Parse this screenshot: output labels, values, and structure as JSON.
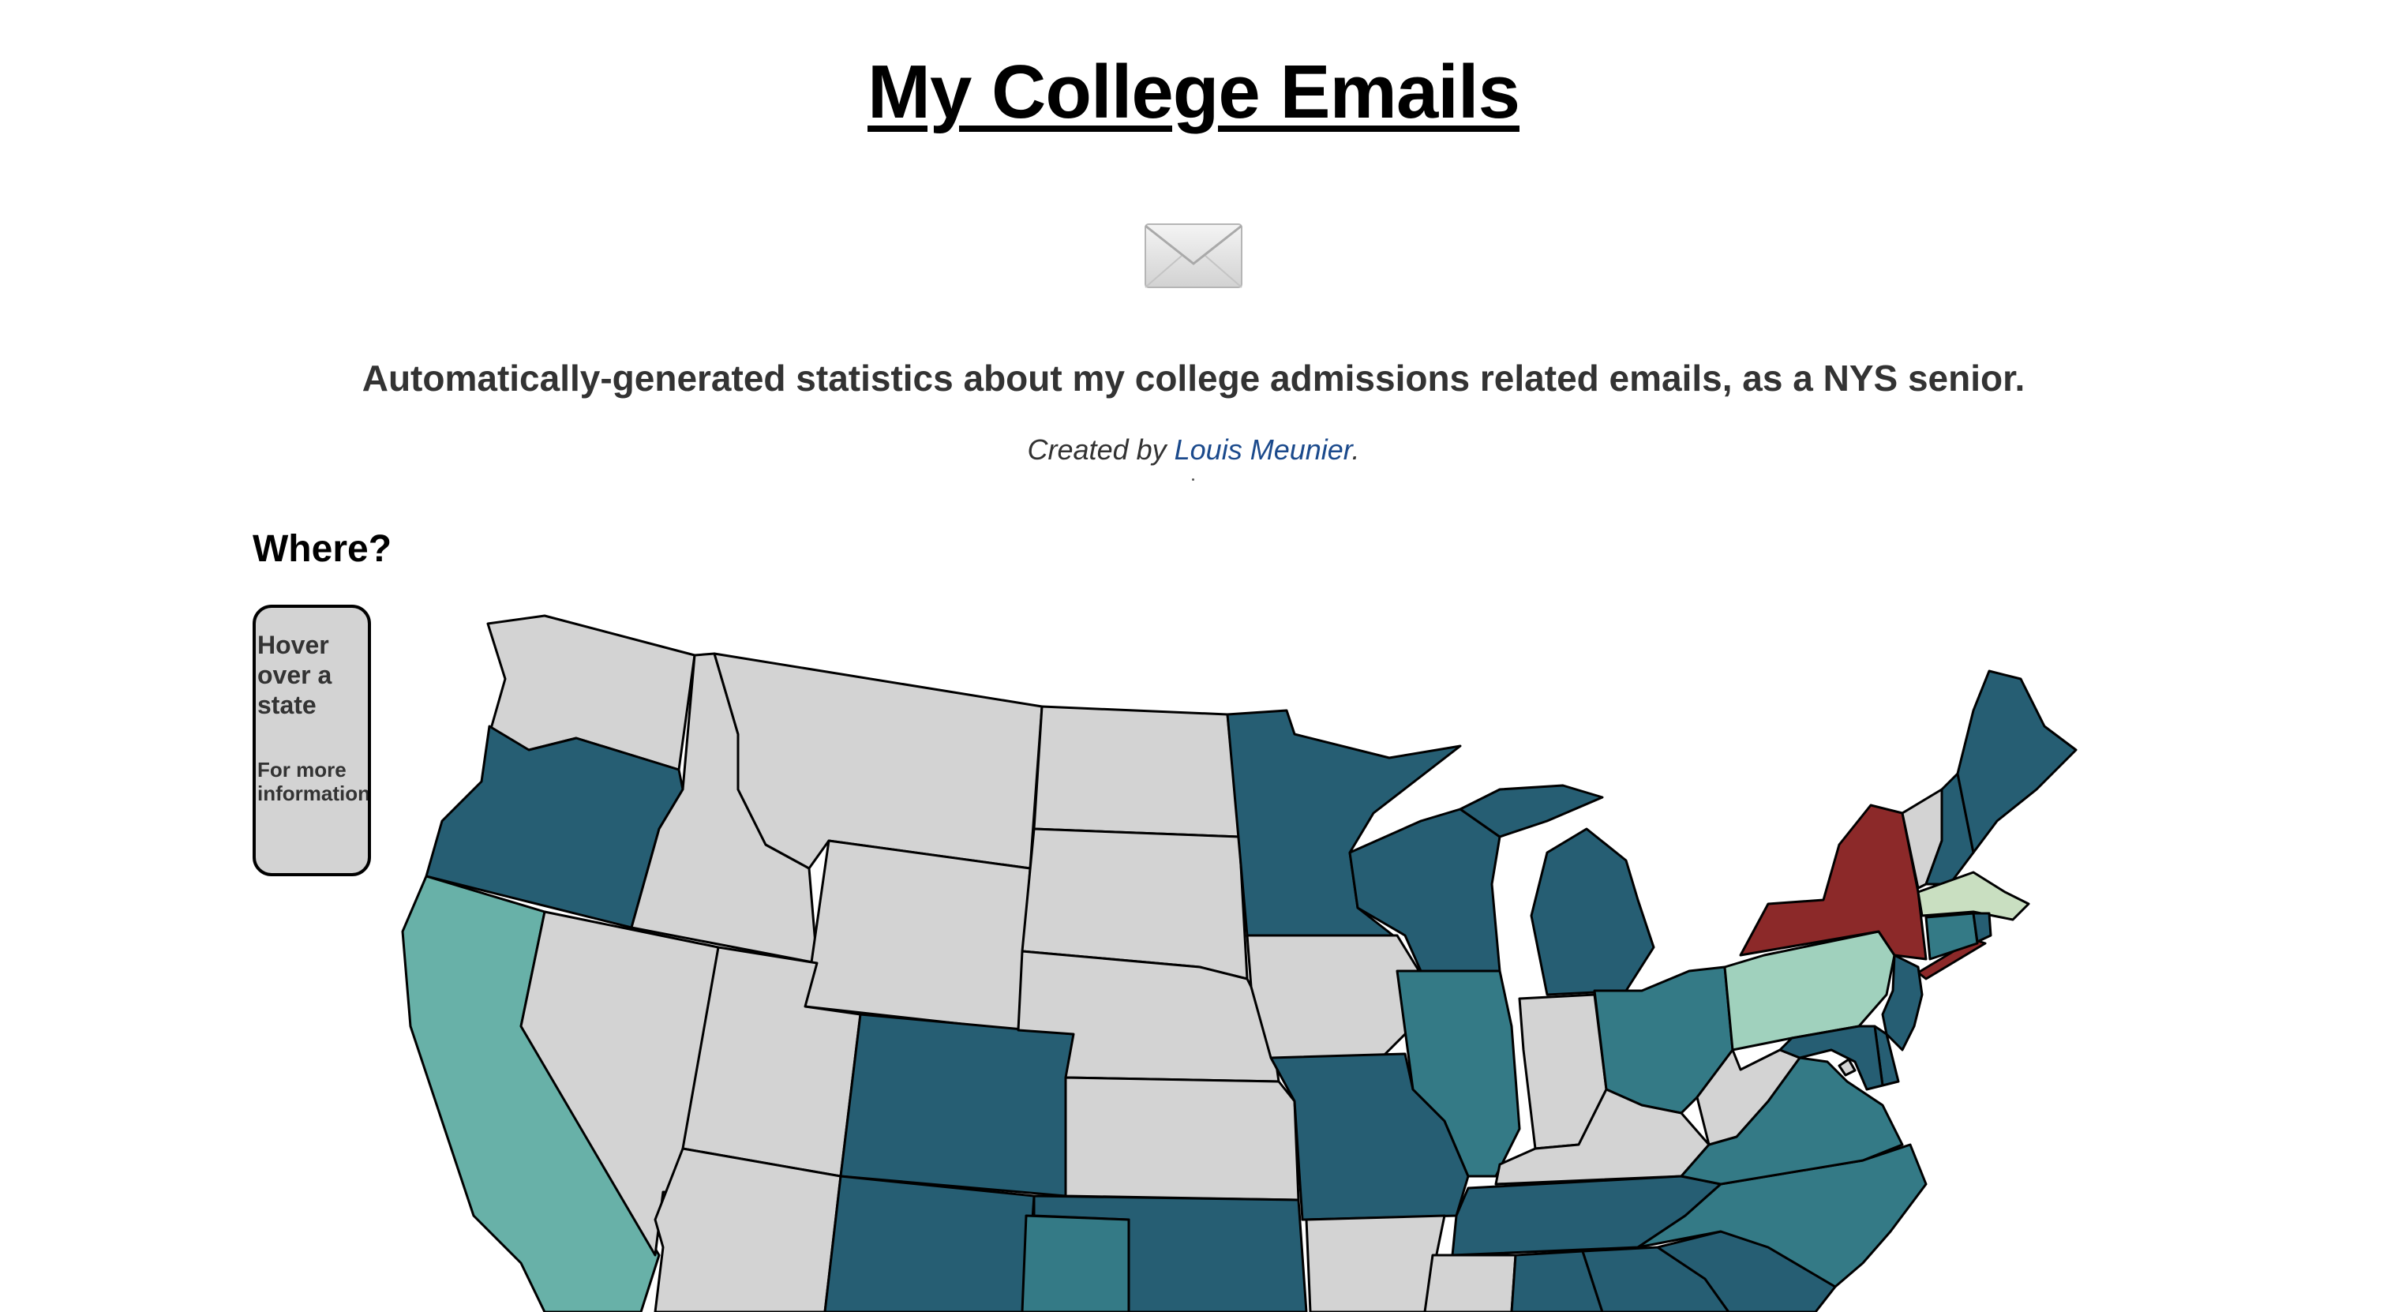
{
  "header": {
    "title": "My College Emails",
    "subtitle": "Automatically-generated statistics about my college admissions related emails, as a NYS senior.",
    "credit_prefix": "Created by ",
    "credit_link": "Louis Meunier",
    "credit_suffix": "."
  },
  "map_section": {
    "heading": "Where?",
    "tooltip_title": "Hover over a state",
    "tooltip_subtitle": "For more information"
  },
  "colors": {
    "no_emails": "#d3d3d3",
    "dark_teal": "#265e73",
    "mid_teal": "#347a86",
    "light_teal": "#68b1a8",
    "mint": "#a0d1bd",
    "pale_green": "#c9dfc1",
    "home_state_red": "#8c2929"
  },
  "icons": {
    "header": "envelope-icon"
  },
  "states": {
    "WA": "#d3d3d3",
    "OR": "#265e73",
    "CA": "#68b1a8",
    "ID": "#d3d3d3",
    "NV": "#d3d3d3",
    "MT": "#d3d3d3",
    "WY": "#d3d3d3",
    "UT": "#d3d3d3",
    "AZ": "#d3d3d3",
    "CO": "#265e73",
    "NM": "#265e73",
    "ND": "#d3d3d3",
    "SD": "#d3d3d3",
    "NE": "#d3d3d3",
    "KS": "#d3d3d3",
    "OK": "#265e73",
    "TX": "#347a86",
    "MN": "#265e73",
    "IA": "#d3d3d3",
    "MO": "#265e73",
    "AR": "#d3d3d3",
    "WI": "#265e73",
    "IL": "#347a86",
    "MI": "#265e73",
    "IN": "#d3d3d3",
    "OH": "#347a86",
    "KY": "#d3d3d3",
    "TN": "#265e73",
    "MS": "#d3d3d3",
    "AL": "#265e73",
    "GA": "#265e73",
    "SC": "#265e73",
    "NC": "#347a86",
    "VA": "#347a86",
    "WV": "#d3d3d3",
    "PA": "#a0d1bd",
    "NY": "#8c2929",
    "VT": "#d3d3d3",
    "NH": "#265e73",
    "ME": "#265e73",
    "MA": "#c9dfc1",
    "CT": "#347a86",
    "RI": "#265e73",
    "NJ": "#265e73",
    "DE": "#265e73",
    "MD": "#265e73",
    "DC": "#d3d3d3"
  }
}
